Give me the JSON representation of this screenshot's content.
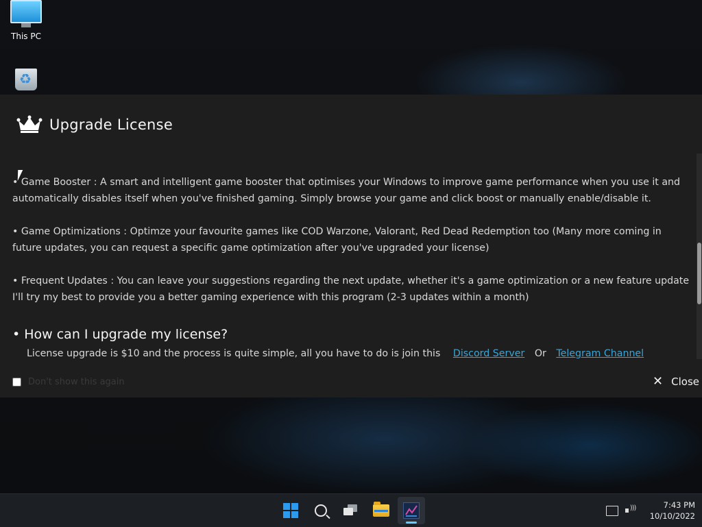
{
  "desktop": {
    "icons": [
      {
        "label": "This PC"
      },
      {
        "label": ""
      }
    ]
  },
  "dialog": {
    "title": "Upgrade License",
    "features": [
      "• Game Booster : A smart and intelligent game booster that optimises your Windows to improve game performance when you use it and automatically disables itself when you've finished gaming. Simply browse your game and click boost or manually enable/disable it.",
      "• Game Optimizations : Optimze your favourite games like COD Warzone, Valorant, Red Dead Redemption too (Many more coming in future updates, you can request a specific game optimization after you've upgraded your license)",
      "• Frequent Updates : You can leave your suggestions regarding the next update, whether it's a game optimization or a new feature update I'll try my best to provide you a better gaming experience with this program (2-3 updates within a month)"
    ],
    "question": "• How can I upgrade my license?",
    "answer_text": "License upgrade is $10 and the process is quite simple, all you have to do is join this",
    "discord_link": "Discord Server",
    "or_text": "Or",
    "telegram_link": "Telegram Channel",
    "dont_show_label": "Don't show this again",
    "close_label": "Close"
  },
  "taskbar": {
    "time": "7:43 PM",
    "date": "10/10/2022"
  },
  "colors": {
    "link": "#3aa6d8",
    "dialog_bg": "#1e1e1e",
    "accent": "#60cdff"
  }
}
